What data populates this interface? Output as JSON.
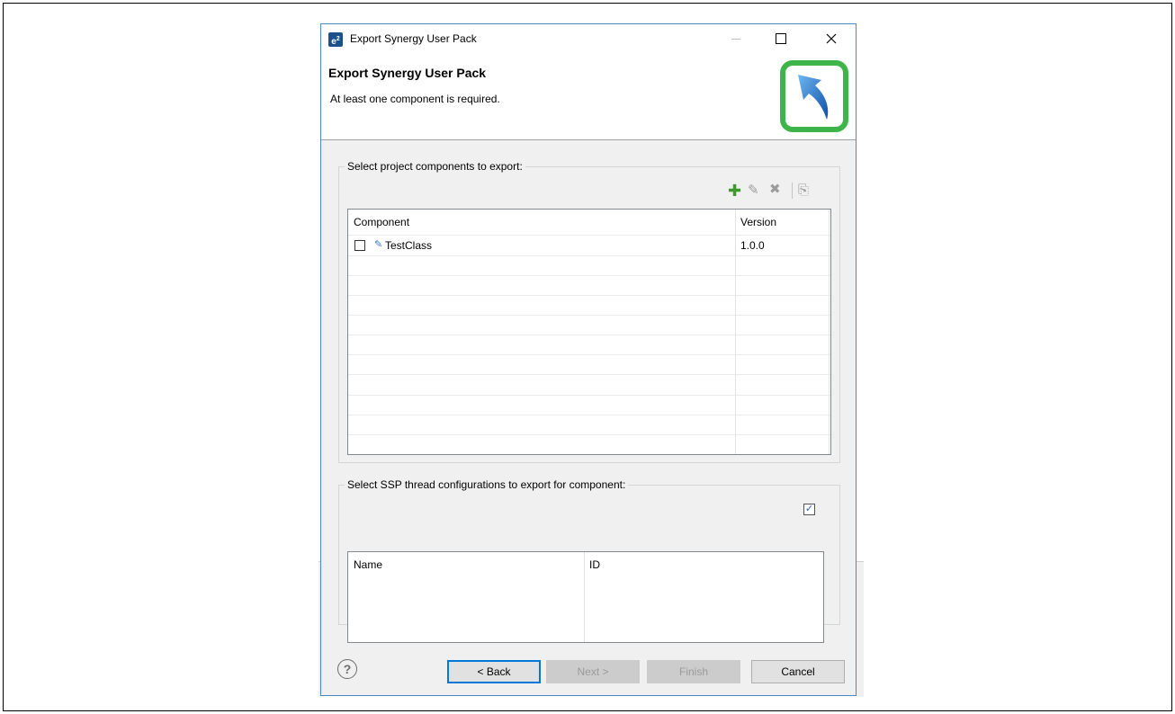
{
  "window": {
    "title": "Export Synergy User Pack",
    "icon": "e2-studio-icon"
  },
  "header": {
    "title": "Export Synergy User Pack",
    "message": "At least one component is required.",
    "logo": "export-arrow-icon",
    "logo_highlight_color": "#3db549"
  },
  "components": {
    "group_label": "Select project components to export:",
    "toolbar": [
      "add-icon",
      "edit-icon",
      "delete-icon",
      "export-icon"
    ],
    "columns": [
      "Component",
      "Version"
    ],
    "rows": [
      {
        "checked": false,
        "name": "TestClass",
        "version": "1.0.0"
      }
    ]
  },
  "threads": {
    "group_label": "Select SSP thread configurations to export for component:",
    "select_all_checked": true,
    "columns": [
      "Name",
      "ID"
    ]
  },
  "buttons": {
    "back": "< Back",
    "next": "Next >",
    "finish": "Finish",
    "cancel": "Cancel",
    "help": "?"
  },
  "colors": {
    "accent": "#0078d7",
    "dialog_border": "#4a88c9"
  }
}
